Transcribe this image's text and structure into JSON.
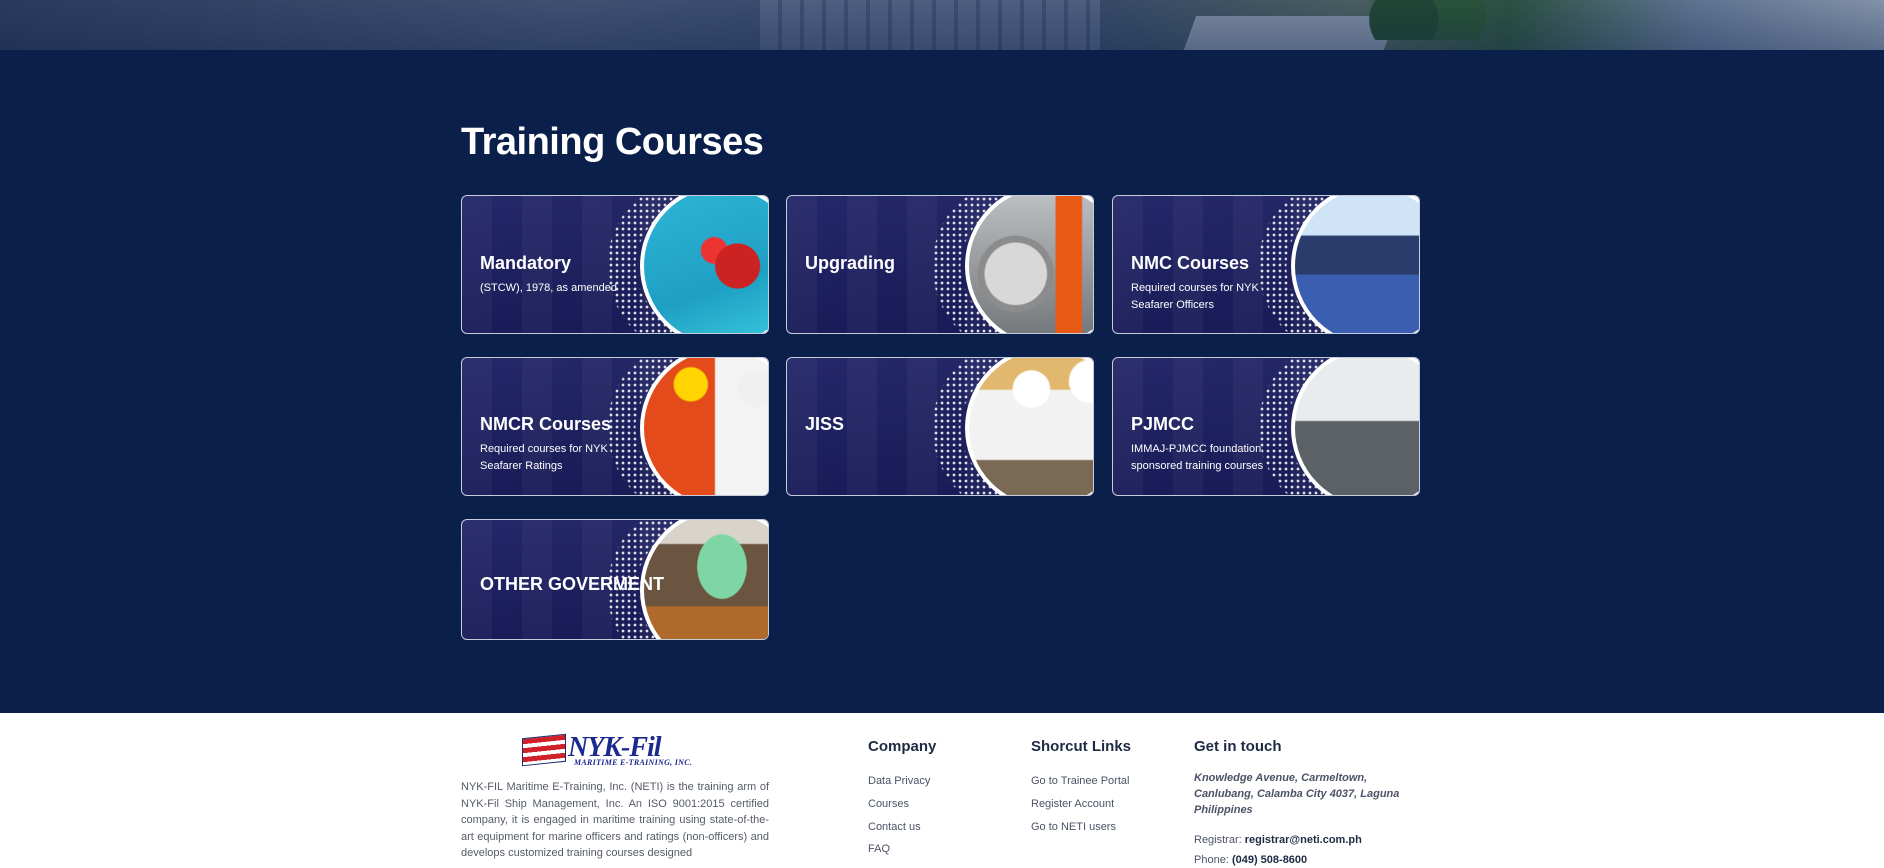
{
  "section": {
    "title": "Training Courses"
  },
  "courses": [
    {
      "title": "Mandatory",
      "subtitle": "(STCW), 1978, as amended"
    },
    {
      "title": "Upgrading",
      "subtitle": ""
    },
    {
      "title": "NMC Courses",
      "subtitle": "Required courses for NYK Seafarer Officers"
    },
    {
      "title": "NMCR Courses",
      "subtitle": "Required courses for NYK Seafarer Ratings"
    },
    {
      "title": "JISS",
      "subtitle": ""
    },
    {
      "title": "PJMCC",
      "subtitle": "IMMAJ-PJMCC foundation sponsored training courses"
    },
    {
      "title": "OTHER GOVERMENT",
      "subtitle": ""
    }
  ],
  "footer": {
    "logo_text": "NYK-Fil",
    "logo_sub": "MARITIME E-TRAINING, INC.",
    "about": "NYK-FIL Maritime E-Training, Inc. (NETI) is the training arm of NYK-Fil Ship Management, Inc. An ISO 9001:2015 certified company, it is engaged in maritime training using state-of-the-art equipment for marine officers and ratings (non-officers) and develops customized training courses designed",
    "company": {
      "title": "Company",
      "links": [
        "Data Privacy",
        "Courses",
        "Contact us",
        "FAQ"
      ]
    },
    "shortcuts": {
      "title": "Shorcut Links",
      "links": [
        "Go to Trainee Portal",
        "Register Account",
        "Go to NETI users"
      ]
    },
    "contact": {
      "title": "Get in touch",
      "address": "Knowledge Avenue, Carmeltown, Canlubang, Calamba City 4037, Laguna Philippines",
      "registrar_label": "Registrar:",
      "registrar_email": "registrar@neti.com.ph",
      "phone_label": "Phone:",
      "phone": "(049) 508-8600"
    }
  },
  "colors": {
    "section_bg": "#0a1f4a",
    "card_bg": "#1c1f63",
    "footer_bg": "#ffffff",
    "footer_heading": "#1f2a44"
  }
}
